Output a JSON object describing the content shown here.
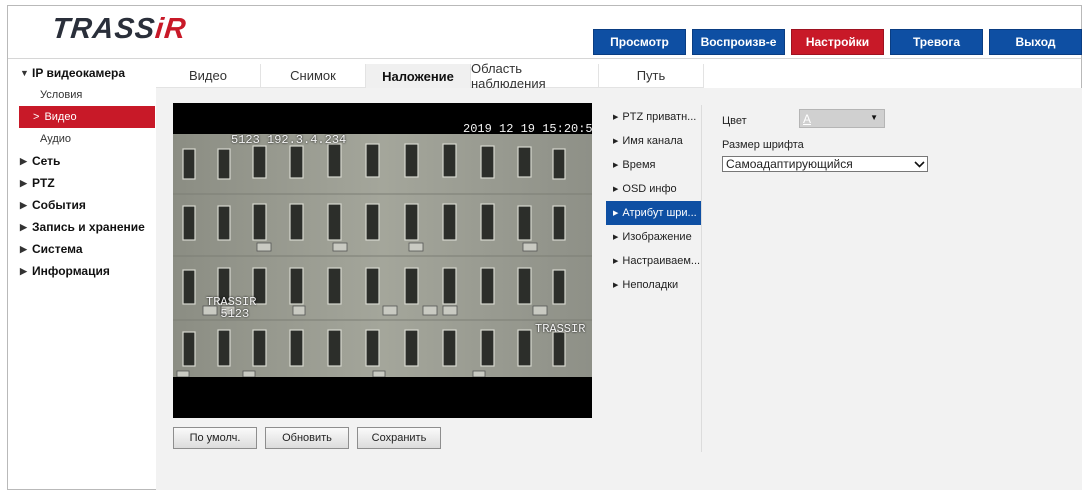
{
  "logo": {
    "part1": "TRASS",
    "part2": "iR"
  },
  "nav": [
    {
      "label": "Просмотр"
    },
    {
      "label": "Воспроизв-е"
    },
    {
      "label": "Настройки"
    },
    {
      "label": "Тревога"
    },
    {
      "label": "Выход"
    }
  ],
  "sidebar": {
    "sections": [
      {
        "label": "IP видеокамера",
        "arrow": "▼"
      },
      {
        "label": "Сеть",
        "arrow": "▶"
      },
      {
        "label": "PTZ",
        "arrow": "▶"
      },
      {
        "label": "События",
        "arrow": "▶"
      },
      {
        "label": "Запись и хранение",
        "arrow": "▶"
      },
      {
        "label": "Система",
        "arrow": "▶"
      },
      {
        "label": "Информация",
        "arrow": "▶"
      }
    ],
    "sub_items": [
      {
        "label": "Условия"
      },
      {
        "label": "Видео",
        "chevron": ">"
      },
      {
        "label": "Аудио"
      }
    ]
  },
  "tabs": [
    {
      "label": "Видео"
    },
    {
      "label": "Снимок"
    },
    {
      "label": "Наложение"
    },
    {
      "label": "Область наблюдения"
    },
    {
      "label": "Путь"
    }
  ],
  "preview": {
    "channel_osd": "5123 192.3.4.234",
    "time_osd": "2019 12 19 15:20:54",
    "info_osd": "TRASSIR\n  5123",
    "watermark": "TRASSIR"
  },
  "buttons": {
    "default": "По умолч.",
    "refresh": "Обновить",
    "save": "Сохранить"
  },
  "menu": [
    {
      "label": "PTZ приватн..."
    },
    {
      "label": "Имя канала"
    },
    {
      "label": "Время"
    },
    {
      "label": "OSD инфо"
    },
    {
      "label": "Атрибут шри..."
    },
    {
      "label": "Изображение"
    },
    {
      "label": "Настраиваем..."
    },
    {
      "label": "Неполадки"
    }
  ],
  "form": {
    "color_label": "Цвет",
    "color_value": "A",
    "font_size_label": "Размер шрифта",
    "font_size_value": "Самоадаптирующийся"
  },
  "colors": {
    "brand_blue": "#0e4fa3",
    "brand_red": "#c81928"
  }
}
